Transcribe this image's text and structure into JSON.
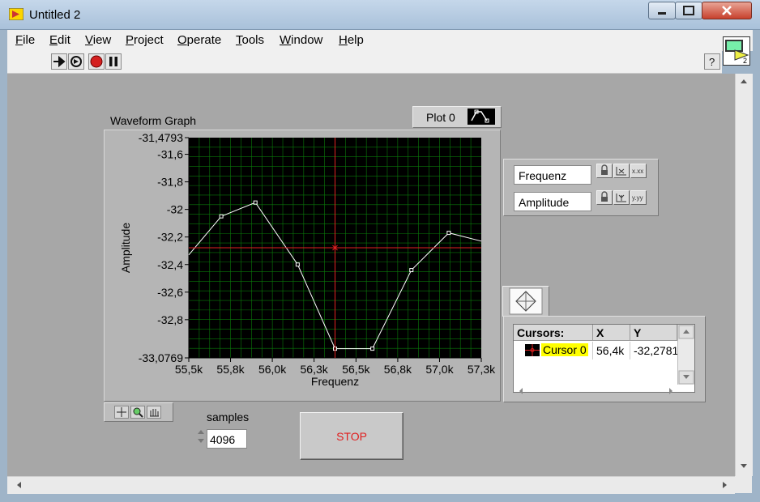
{
  "window": {
    "title": "Untitled 2",
    "vi_icon_number": "2"
  },
  "menu": [
    {
      "pre": "",
      "key": "F",
      "post": "ile"
    },
    {
      "pre": "",
      "key": "E",
      "post": "dit"
    },
    {
      "pre": "",
      "key": "V",
      "post": "iew"
    },
    {
      "pre": "",
      "key": "P",
      "post": "roject"
    },
    {
      "pre": "",
      "key": "O",
      "post": "perate"
    },
    {
      "pre": "",
      "key": "T",
      "post": "ools"
    },
    {
      "pre": "",
      "key": "W",
      "post": "indow"
    },
    {
      "pre": "",
      "key": "H",
      "post": "elp"
    }
  ],
  "toolbar": {
    "icons": [
      "run-arrow-icon",
      "run-continuously-icon",
      "abort-icon",
      "pause-icon"
    ],
    "help_icon": "context-help-icon",
    "help_label": "?"
  },
  "graph": {
    "label": "Waveform Graph",
    "plot_legend_label": "Plot 0",
    "colors": {
      "background": "#000000",
      "grid": "#0a7a0a",
      "trace": "#ffffff",
      "cursor": "#e02020"
    }
  },
  "chart_data": {
    "type": "line",
    "xlabel": "Frequenz",
    "ylabel": "Amplitude",
    "xlim": [
      55500,
      57300
    ],
    "ylim": [
      -33.0769,
      -31.4793
    ],
    "x_tick_labels": [
      "55,5k",
      "55,8k",
      "56,0k",
      "56,3k",
      "56,5k",
      "56,8k",
      "57,0k",
      "57,3k"
    ],
    "x_ticks": [
      55500,
      55757,
      56014,
      56271,
      56529,
      56786,
      57043,
      57300
    ],
    "y_tick_labels": [
      "-31,4793",
      "-31,6",
      "-31,8",
      "-32",
      "-32,2",
      "-32,4",
      "-32,6",
      "-32,8",
      "-33,0769"
    ],
    "y_ticks": [
      -31.4793,
      -31.6,
      -31.8,
      -32.0,
      -32.2,
      -32.4,
      -32.6,
      -32.8,
      -33.0769
    ],
    "grid": true,
    "series": [
      {
        "values_x": [
          55500,
          55700,
          55910,
          56170,
          56400,
          56630,
          56870,
          57100,
          57300
        ],
        "values_y": [
          -32.33,
          -32.05,
          -31.95,
          -32.4,
          -33.01,
          -33.01,
          -32.44,
          -32.17,
          -32.23
        ],
        "markers": [
          false,
          true,
          true,
          true,
          true,
          true,
          true,
          true,
          false
        ]
      }
    ],
    "cursor": {
      "x": 56400,
      "y": -32.2781
    }
  },
  "scale_legend": {
    "x_name": "Frequenz",
    "y_name": "Amplitude",
    "x_format_icon": "x-format-icon",
    "y_format_icon": "y-format-icon"
  },
  "cursor_legend": {
    "headers": [
      "Cursors:",
      "X",
      "Y"
    ],
    "rows": [
      {
        "name": "Cursor 0",
        "x": "56,4k",
        "y": "-32,2781"
      }
    ]
  },
  "samples": {
    "label": "samples",
    "value": "4096"
  },
  "stop_button": {
    "label": "STOP"
  }
}
